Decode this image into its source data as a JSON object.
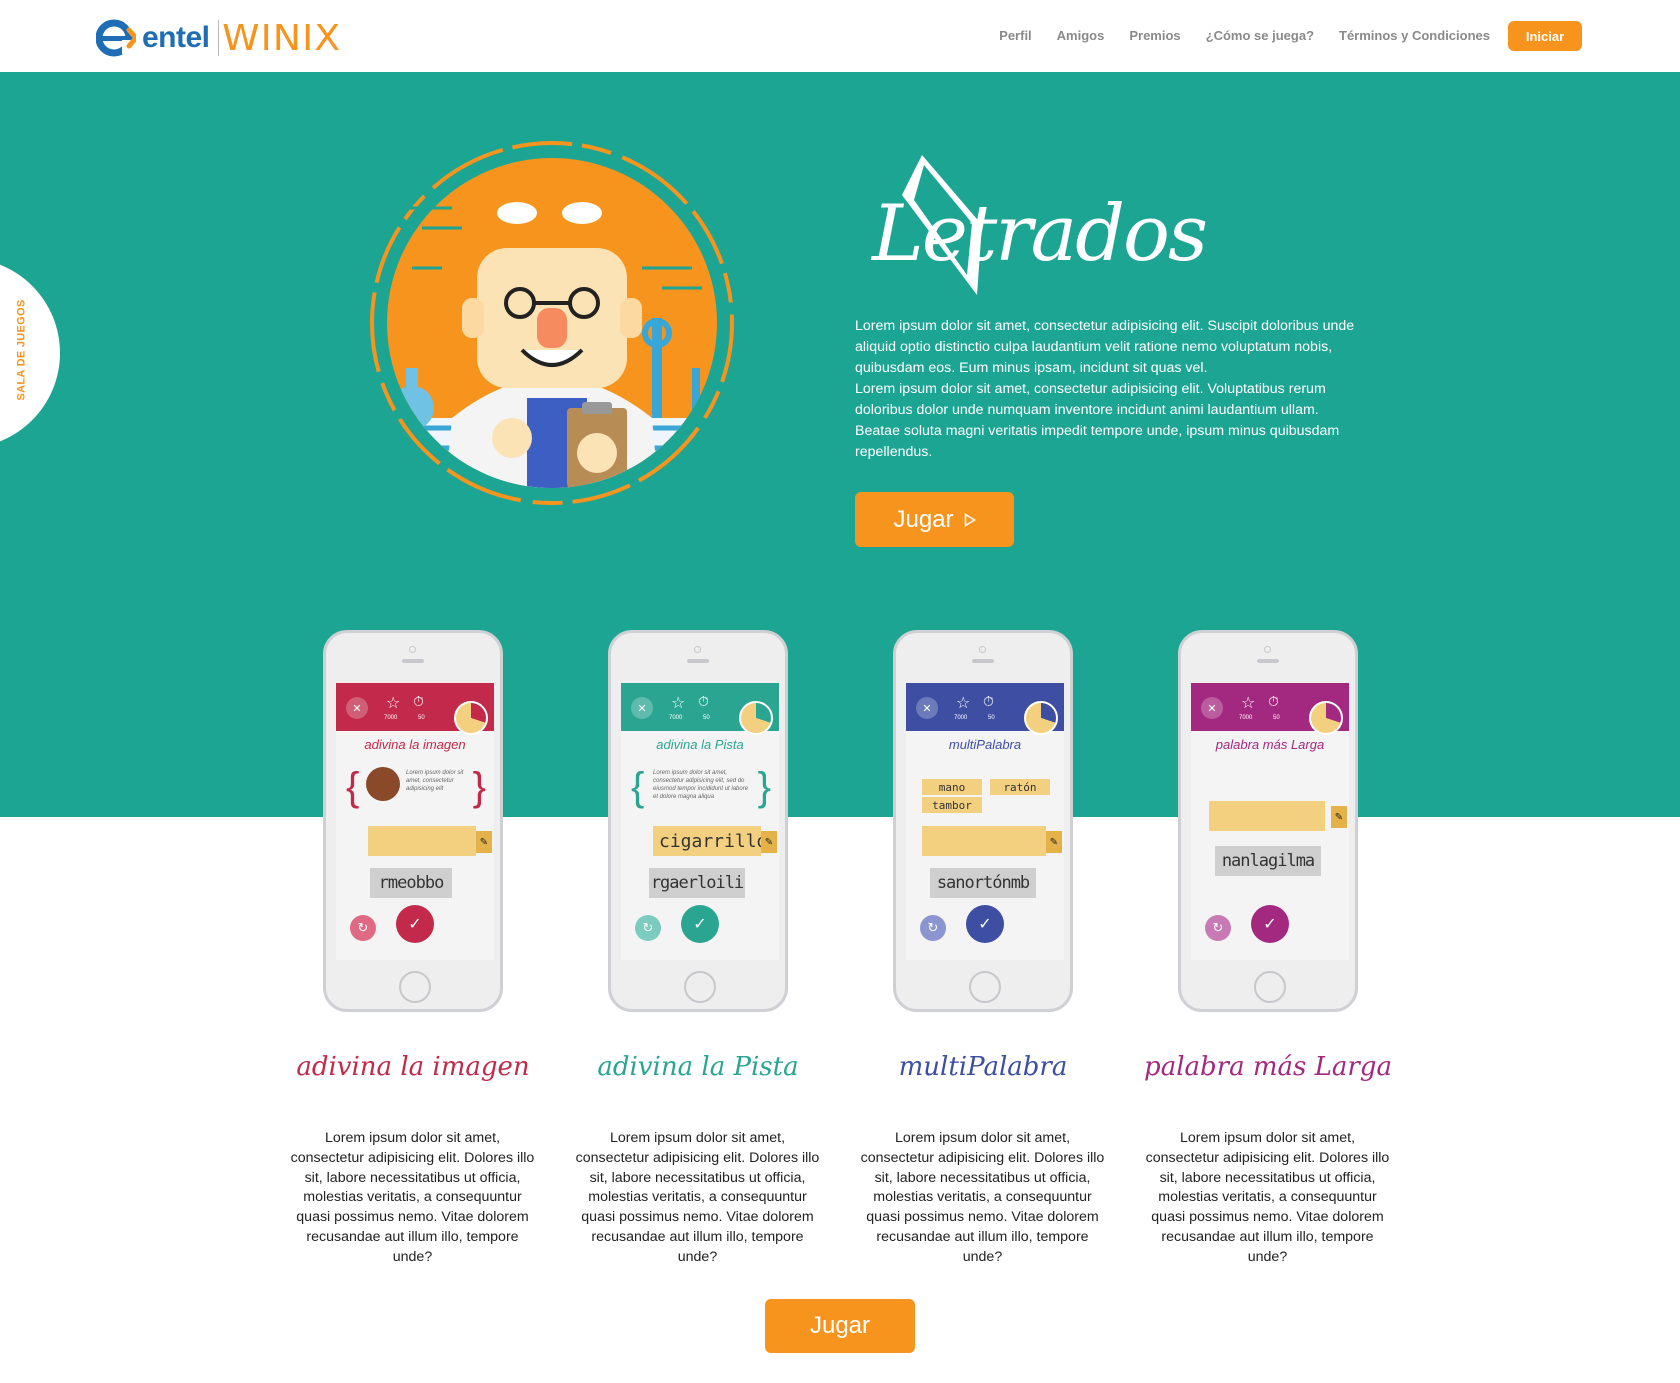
{
  "header": {
    "logo_entel": "entel",
    "logo_winix": "WINIX",
    "nav": [
      "Perfil",
      "Amigos",
      "Premios",
      "¿Cómo se juega?",
      "Términos y Condiciones"
    ],
    "cta": "Iniciar"
  },
  "side_tab": {
    "label": "SALA DE JUEGOS"
  },
  "hero": {
    "game_logo": "Letrados",
    "paragraph_1": "Lorem ipsum dolor sit amet, consectetur adipisicing elit. Suscipit doloribus unde aliquid optio distinctio culpa laudantium velit ratione nemo voluptatum nobis, quibusdam eos. Eum minus ipsam, incidunt sit quas vel.",
    "paragraph_2": "Lorem ipsum dolor sit amet, consectetur adipisicing elit. Voluptatibus rerum doloribus dolor unde numquam inventore incidunt animi laudantium ullam. Beatae soluta magni veritatis impedit tempore unde, ipsum minus quibusdam repellendus.",
    "play_button": "Jugar"
  },
  "colors": {
    "teal": "#1da594",
    "orange": "#f7941d",
    "red": "#c2294a",
    "green": "#2aa592",
    "blue": "#3d4ea3",
    "purple": "#a3287f"
  },
  "games": [
    {
      "name": "adivina la imagen",
      "screen_title": "adivina la imagen",
      "stars": "7000",
      "time": "50",
      "answer": "",
      "letters": "rmeobbo",
      "hint": "Lorem ipsum dolor sit amet, consectetur adipisicing elit",
      "description": "Lorem ipsum dolor sit amet, consectetur adipisicing elit. Dolores illo sit, labore necessitatibus ut officia, molestias veritatis, a consequuntur quasi possimus nemo. Vitae dolorem recusandae aut illum illo, tempore unde?"
    },
    {
      "name": "adivina la Pista",
      "screen_title": "adivina la Pista",
      "stars": "7000",
      "time": "50",
      "answer": "cigarrillo",
      "letters": "rgaerloili",
      "hint": "Lorem ipsum dolor sit amet, consectetur adipisicing elit, sed do eiusmod tempor incididunt ut labore et dolore magna aliqua",
      "description": "Lorem ipsum dolor sit amet, consectetur adipisicing elit. Dolores illo sit, labore necessitatibus ut officia, molestias veritatis, a consequuntur quasi possimus nemo. Vitae dolorem recusandae aut illum illo, tempore unde?"
    },
    {
      "name": "multiPalabra",
      "screen_title": "multiPalabra",
      "stars": "7000",
      "time": "50",
      "answer": "",
      "letters": "sanortónmb",
      "chips": [
        "mano",
        "ratón",
        "tambor"
      ],
      "description": "Lorem ipsum dolor sit amet, consectetur adipisicing elit. Dolores illo sit, labore necessitatibus ut officia, molestias veritatis, a consequuntur quasi possimus nemo. Vitae dolorem recusandae aut illum illo, tempore unde?"
    },
    {
      "name": "palabra más Larga",
      "screen_title": "palabra más Larga",
      "stars": "7000",
      "time": "50",
      "answer": "",
      "letters": "nanlagilma",
      "description": "Lorem ipsum dolor sit amet, consectetur adipisicing elit. Dolores illo sit, labore necessitatibus ut officia, molestias veritatis, a consequuntur quasi possimus nemo. Vitae dolorem recusandae aut illum illo, tempore unde?"
    }
  ],
  "bottom": {
    "play_button": "Jugar"
  },
  "icons": [
    "entel-logo-icon",
    "play-icon",
    "close-icon",
    "star-icon",
    "stopwatch-icon",
    "pie-timer-icon",
    "eraser-icon",
    "refresh-icon",
    "check-icon"
  ]
}
